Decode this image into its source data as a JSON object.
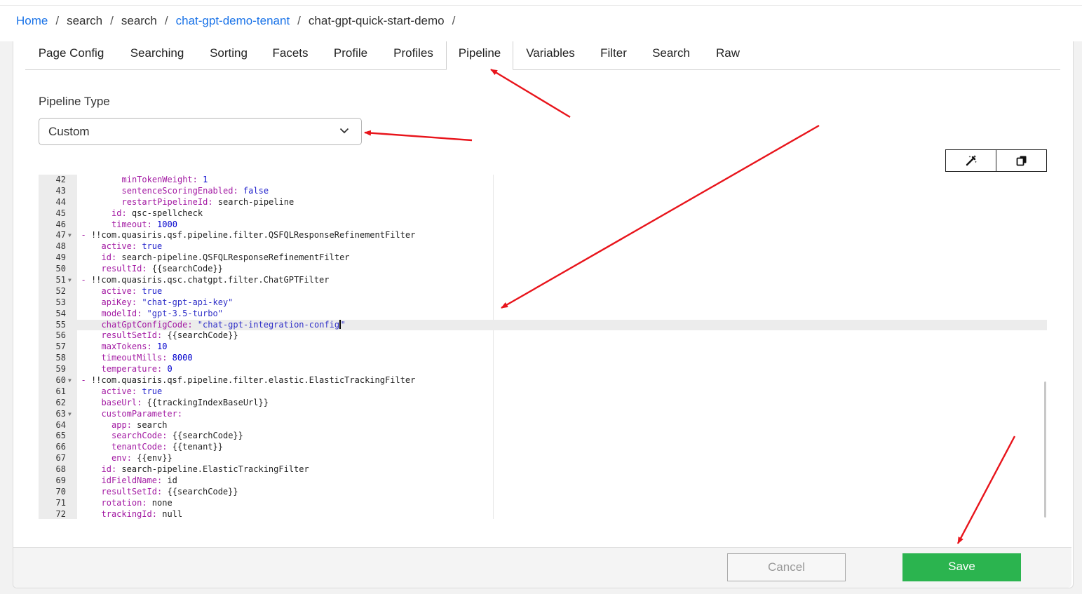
{
  "breadcrumb": [
    {
      "label": "Home",
      "link": true
    },
    {
      "label": "search",
      "link": false
    },
    {
      "label": "search",
      "link": false
    },
    {
      "label": "chat-gpt-demo-tenant",
      "link": true
    },
    {
      "label": "chat-gpt-quick-start-demo",
      "link": false
    }
  ],
  "breadcrumb_separator": "/",
  "tabs": [
    "Page Config",
    "Searching",
    "Sorting",
    "Facets",
    "Profile",
    "Profiles",
    "Pipeline",
    "Variables",
    "Filter",
    "Search",
    "Raw"
  ],
  "active_tab": "Pipeline",
  "pipeline_type": {
    "label": "Pipeline Type",
    "value": "Custom"
  },
  "toolbar_icons": [
    "magic-wand-icon",
    "copy-icon"
  ],
  "editor": {
    "current_line": 55,
    "lines": [
      {
        "n": 42,
        "indent": 3,
        "key": "minTokenWeight",
        "value": "1",
        "vtype": "num"
      },
      {
        "n": 43,
        "indent": 3,
        "key": "sentenceScoringEnabled",
        "value": "false",
        "vtype": "bool"
      },
      {
        "n": 44,
        "indent": 3,
        "key": "restartPipelineId",
        "value": "search-pipeline",
        "vtype": "plain"
      },
      {
        "n": 45,
        "indent": 2,
        "key": "id",
        "value": "qsc-spellcheck",
        "vtype": "plain"
      },
      {
        "n": 46,
        "indent": 2,
        "key": "timeout",
        "value": "1000",
        "vtype": "num"
      },
      {
        "n": 47,
        "indent": 1,
        "text": "!!com.quasiris.qsf.pipeline.filter.QSFQLResponseRefinementFilter",
        "dash": true,
        "fold": true
      },
      {
        "n": 48,
        "indent": 1,
        "key": "active",
        "value": "true",
        "vtype": "bool"
      },
      {
        "n": 49,
        "indent": 1,
        "key": "id",
        "value": "search-pipeline.QSFQLResponseRefinementFilter",
        "vtype": "plain"
      },
      {
        "n": 50,
        "indent": 1,
        "key": "resultId",
        "value": "{{searchCode}}",
        "vtype": "plain"
      },
      {
        "n": 51,
        "indent": 1,
        "text": "!!com.quasiris.qsc.chatgpt.filter.ChatGPTFilter",
        "dash": true,
        "fold": true
      },
      {
        "n": 52,
        "indent": 1,
        "key": "active",
        "value": "true",
        "vtype": "bool"
      },
      {
        "n": 53,
        "indent": 1,
        "key": "apiKey",
        "value": "\"chat-gpt-api-key\"",
        "vtype": "str"
      },
      {
        "n": 54,
        "indent": 1,
        "key": "modelId",
        "value": "\"gpt-3.5-turbo\"",
        "vtype": "str"
      },
      {
        "n": 55,
        "indent": 1,
        "key": "chatGptConfigCode",
        "value": "\"chat-gpt-integration-config\"",
        "vtype": "str",
        "cursor": true
      },
      {
        "n": 56,
        "indent": 1,
        "key": "resultSetId",
        "value": "{{searchCode}}",
        "vtype": "plain"
      },
      {
        "n": 57,
        "indent": 1,
        "key": "maxTokens",
        "value": "10",
        "vtype": "num"
      },
      {
        "n": 58,
        "indent": 1,
        "key": "timeoutMills",
        "value": "8000",
        "vtype": "num"
      },
      {
        "n": 59,
        "indent": 1,
        "key": "temperature",
        "value": "0",
        "vtype": "num"
      },
      {
        "n": 60,
        "indent": 1,
        "text": "!!com.quasiris.qsf.pipeline.filter.elastic.ElasticTrackingFilter",
        "dash": true,
        "fold": true
      },
      {
        "n": 61,
        "indent": 1,
        "key": "active",
        "value": "true",
        "vtype": "bool"
      },
      {
        "n": 62,
        "indent": 1,
        "key": "baseUrl",
        "value": "{{trackingIndexBaseUrl}}",
        "vtype": "plain"
      },
      {
        "n": 63,
        "indent": 1,
        "key": "customParameter",
        "value": "",
        "vtype": "plain",
        "fold": true
      },
      {
        "n": 64,
        "indent": 2,
        "key": "app",
        "value": "search",
        "vtype": "plain"
      },
      {
        "n": 65,
        "indent": 2,
        "key": "searchCode",
        "value": "{{searchCode}}",
        "vtype": "plain"
      },
      {
        "n": 66,
        "indent": 2,
        "key": "tenantCode",
        "value": "{{tenant}}",
        "vtype": "plain"
      },
      {
        "n": 67,
        "indent": 2,
        "key": "env",
        "value": "{{env}}",
        "vtype": "plain"
      },
      {
        "n": 68,
        "indent": 1,
        "key": "id",
        "value": "search-pipeline.ElasticTrackingFilter",
        "vtype": "plain"
      },
      {
        "n": 69,
        "indent": 1,
        "key": "idFieldName",
        "value": "id",
        "vtype": "plain"
      },
      {
        "n": 70,
        "indent": 1,
        "key": "resultSetId",
        "value": "{{searchCode}}",
        "vtype": "plain"
      },
      {
        "n": 71,
        "indent": 1,
        "key": "rotation",
        "value": "none",
        "vtype": "plain"
      },
      {
        "n": 72,
        "indent": 1,
        "key": "trackingId",
        "value": "null",
        "vtype": "plain"
      }
    ]
  },
  "footer": {
    "cancel_label": "Cancel",
    "save_label": "Save"
  },
  "colors": {
    "link": "#1a73e8",
    "save": "#2bb44f",
    "annotation_arrow": "#e8141b",
    "yaml_key": "#a31aa3",
    "yaml_bool": "#2222cc"
  }
}
